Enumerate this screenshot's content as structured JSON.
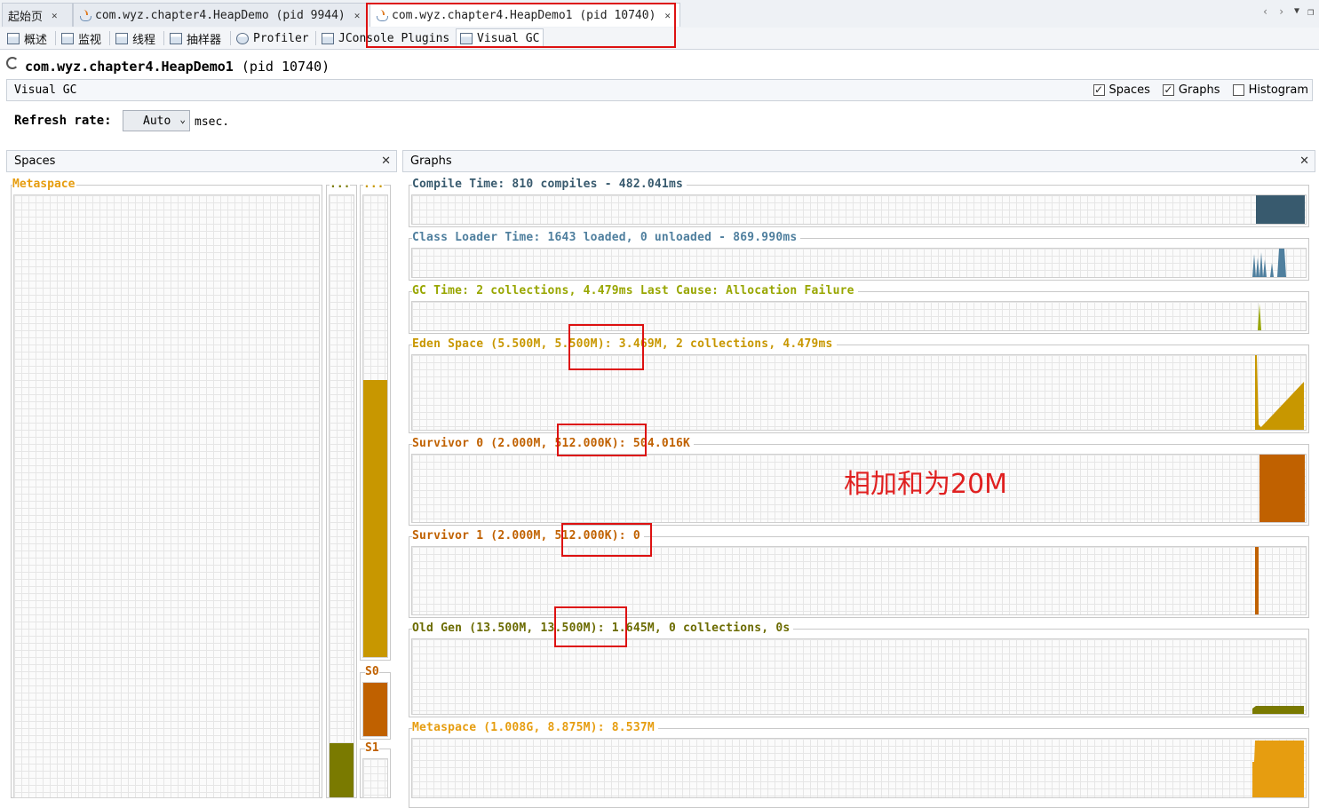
{
  "tabs": [
    {
      "label": "起始页",
      "active": false
    },
    {
      "label": "com.wyz.chapter4.HeapDemo (pid 9944)",
      "active": false
    },
    {
      "label": "com.wyz.chapter4.HeapDemo1 (pid 10740)",
      "active": true
    }
  ],
  "subtabs": [
    {
      "label": "概述",
      "icon": "overview-icon"
    },
    {
      "label": "监视",
      "icon": "monitor-icon"
    },
    {
      "label": "线程",
      "icon": "threads-icon"
    },
    {
      "label": "抽样器",
      "icon": "sampler-icon"
    },
    {
      "label": "Profiler",
      "icon": "profiler-icon"
    },
    {
      "label": "JConsole Plugins",
      "icon": "jconsole-icon"
    },
    {
      "label": "Visual GC",
      "icon": "visualgc-icon"
    }
  ],
  "app": {
    "title_main": "com.wyz.chapter4.HeapDemo1",
    "title_pid": "(pid 10740)",
    "section": "Visual GC",
    "options": {
      "spaces": "Spaces",
      "graphs": "Graphs",
      "histogram": "Histogram"
    },
    "options_checked": {
      "spaces": true,
      "graphs": true,
      "histogram": false
    },
    "refresh_label": "Refresh rate:",
    "refresh_value": "Auto",
    "refresh_unit": "msec."
  },
  "spaces": {
    "title": "Spaces",
    "metaspace": "Metaspace",
    "dots1": "...",
    "dots2": "...",
    "s0": "S0",
    "s1": "S1",
    "old_fill": 0.09,
    "eden_fill": 0.6,
    "s0_fill": 1.0
  },
  "graphs": {
    "title": "Graphs",
    "compile": "Compile Time: 810 compiles - 482.041ms",
    "classloader": "Class Loader Time: 1643 loaded, 0 unloaded - 869.990ms",
    "gc": "GC Time: 2 collections, 4.479ms Last Cause: Allocation Failure",
    "eden": "Eden Space (5.500M, 5.500M): 3.469M, 2 collections, 4.479ms",
    "survivor0": "Survivor 0 (2.000M, 512.000K): 504.016K",
    "survivor1": "Survivor 1 (2.000M, 512.000K): 0",
    "oldgen": "Old Gen (13.500M, 13.500M): 1.645M, 0 collections, 0s",
    "metaspace": "Metaspace (1.008G, 8.875M): 8.537M"
  },
  "annotation": "相加和为20M",
  "colors": {
    "compile": "#385a6e",
    "classloader": "#4f7f9e",
    "gc": "#98a600",
    "eden": "#c89700",
    "survivor": "#c06100",
    "oldgen": "#7a7a00",
    "metaspace": "#e69d10",
    "annotation": "#e02020",
    "highlight": "#dd1111"
  }
}
